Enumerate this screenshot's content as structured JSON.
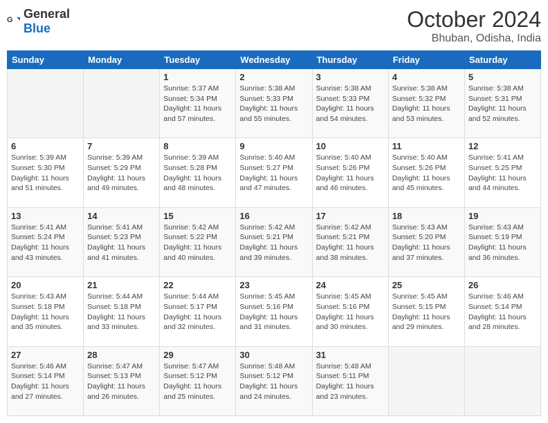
{
  "header": {
    "logo_general": "General",
    "logo_blue": "Blue",
    "month_year": "October 2024",
    "location": "Bhuban, Odisha, India"
  },
  "weekdays": [
    "Sunday",
    "Monday",
    "Tuesday",
    "Wednesday",
    "Thursday",
    "Friday",
    "Saturday"
  ],
  "weeks": [
    [
      null,
      null,
      {
        "day": 1,
        "sunrise": "5:37 AM",
        "sunset": "5:34 PM",
        "daylight": "11 hours and 57 minutes."
      },
      {
        "day": 2,
        "sunrise": "5:38 AM",
        "sunset": "5:33 PM",
        "daylight": "11 hours and 55 minutes."
      },
      {
        "day": 3,
        "sunrise": "5:38 AM",
        "sunset": "5:33 PM",
        "daylight": "11 hours and 54 minutes."
      },
      {
        "day": 4,
        "sunrise": "5:38 AM",
        "sunset": "5:32 PM",
        "daylight": "11 hours and 53 minutes."
      },
      {
        "day": 5,
        "sunrise": "5:38 AM",
        "sunset": "5:31 PM",
        "daylight": "11 hours and 52 minutes."
      }
    ],
    [
      {
        "day": 6,
        "sunrise": "5:39 AM",
        "sunset": "5:30 PM",
        "daylight": "11 hours and 51 minutes."
      },
      {
        "day": 7,
        "sunrise": "5:39 AM",
        "sunset": "5:29 PM",
        "daylight": "11 hours and 49 minutes."
      },
      {
        "day": 8,
        "sunrise": "5:39 AM",
        "sunset": "5:28 PM",
        "daylight": "11 hours and 48 minutes."
      },
      {
        "day": 9,
        "sunrise": "5:40 AM",
        "sunset": "5:27 PM",
        "daylight": "11 hours and 47 minutes."
      },
      {
        "day": 10,
        "sunrise": "5:40 AM",
        "sunset": "5:26 PM",
        "daylight": "11 hours and 46 minutes."
      },
      {
        "day": 11,
        "sunrise": "5:40 AM",
        "sunset": "5:26 PM",
        "daylight": "11 hours and 45 minutes."
      },
      {
        "day": 12,
        "sunrise": "5:41 AM",
        "sunset": "5:25 PM",
        "daylight": "11 hours and 44 minutes."
      }
    ],
    [
      {
        "day": 13,
        "sunrise": "5:41 AM",
        "sunset": "5:24 PM",
        "daylight": "11 hours and 43 minutes."
      },
      {
        "day": 14,
        "sunrise": "5:41 AM",
        "sunset": "5:23 PM",
        "daylight": "11 hours and 41 minutes."
      },
      {
        "day": 15,
        "sunrise": "5:42 AM",
        "sunset": "5:22 PM",
        "daylight": "11 hours and 40 minutes."
      },
      {
        "day": 16,
        "sunrise": "5:42 AM",
        "sunset": "5:21 PM",
        "daylight": "11 hours and 39 minutes."
      },
      {
        "day": 17,
        "sunrise": "5:42 AM",
        "sunset": "5:21 PM",
        "daylight": "11 hours and 38 minutes."
      },
      {
        "day": 18,
        "sunrise": "5:43 AM",
        "sunset": "5:20 PM",
        "daylight": "11 hours and 37 minutes."
      },
      {
        "day": 19,
        "sunrise": "5:43 AM",
        "sunset": "5:19 PM",
        "daylight": "11 hours and 36 minutes."
      }
    ],
    [
      {
        "day": 20,
        "sunrise": "5:43 AM",
        "sunset": "5:18 PM",
        "daylight": "11 hours and 35 minutes."
      },
      {
        "day": 21,
        "sunrise": "5:44 AM",
        "sunset": "5:18 PM",
        "daylight": "11 hours and 33 minutes."
      },
      {
        "day": 22,
        "sunrise": "5:44 AM",
        "sunset": "5:17 PM",
        "daylight": "11 hours and 32 minutes."
      },
      {
        "day": 23,
        "sunrise": "5:45 AM",
        "sunset": "5:16 PM",
        "daylight": "11 hours and 31 minutes."
      },
      {
        "day": 24,
        "sunrise": "5:45 AM",
        "sunset": "5:16 PM",
        "daylight": "11 hours and 30 minutes."
      },
      {
        "day": 25,
        "sunrise": "5:45 AM",
        "sunset": "5:15 PM",
        "daylight": "11 hours and 29 minutes."
      },
      {
        "day": 26,
        "sunrise": "5:46 AM",
        "sunset": "5:14 PM",
        "daylight": "11 hours and 28 minutes."
      }
    ],
    [
      {
        "day": 27,
        "sunrise": "5:46 AM",
        "sunset": "5:14 PM",
        "daylight": "11 hours and 27 minutes."
      },
      {
        "day": 28,
        "sunrise": "5:47 AM",
        "sunset": "5:13 PM",
        "daylight": "11 hours and 26 minutes."
      },
      {
        "day": 29,
        "sunrise": "5:47 AM",
        "sunset": "5:12 PM",
        "daylight": "11 hours and 25 minutes."
      },
      {
        "day": 30,
        "sunrise": "5:48 AM",
        "sunset": "5:12 PM",
        "daylight": "11 hours and 24 minutes."
      },
      {
        "day": 31,
        "sunrise": "5:48 AM",
        "sunset": "5:11 PM",
        "daylight": "11 hours and 23 minutes."
      },
      null,
      null
    ]
  ],
  "labels": {
    "sunrise": "Sunrise:",
    "sunset": "Sunset:",
    "daylight": "Daylight:"
  }
}
